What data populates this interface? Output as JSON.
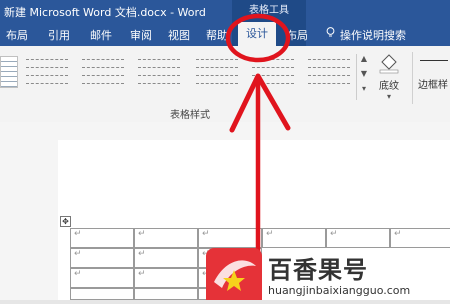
{
  "titlebar": {
    "document_title": "新建 Microsoft Word 文档.docx  -  Word",
    "context_label": "表格工具"
  },
  "ribbon_tabs": [
    {
      "label": "布局"
    },
    {
      "label": "引用"
    },
    {
      "label": "邮件"
    },
    {
      "label": "审阅"
    },
    {
      "label": "视图"
    },
    {
      "label": "帮助"
    },
    {
      "label": "设计",
      "active": true
    },
    {
      "label": "布局"
    }
  ],
  "tell_me": {
    "label": "操作说明搜索"
  },
  "ribbon": {
    "group_table_styles_label": "表格样式",
    "shading_label": "底纹",
    "borders_label": "边框样"
  },
  "table": {
    "cell_mark": "↵"
  },
  "watermark": {
    "brand": "百香果号",
    "url": "huangjinbaixiangguo.com"
  },
  "annotation": {
    "circle_color": "#e0141d",
    "arrow_color": "#e0141d"
  },
  "colors": {
    "title_bar": "#2b579a",
    "context_tab": "#1f4a87",
    "ribbon_bg": "#f3f3f3"
  }
}
